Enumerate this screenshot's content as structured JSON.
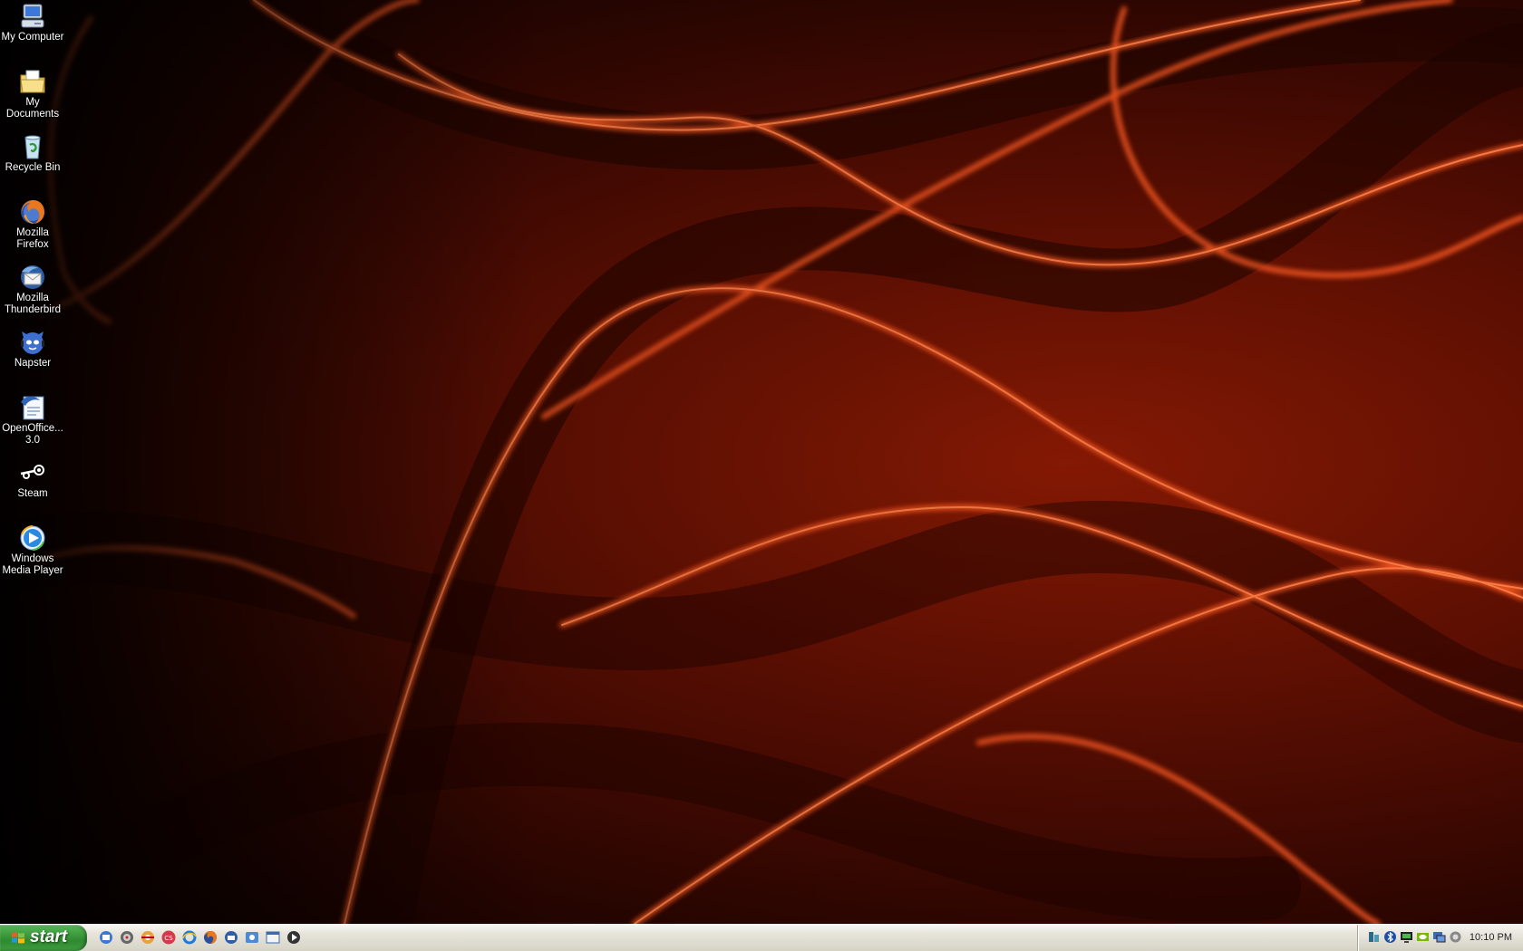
{
  "desktop": {
    "icons": [
      {
        "label": "My Computer",
        "icon": "my-computer-icon"
      },
      {
        "label": "My Documents",
        "icon": "my-documents-icon"
      },
      {
        "label": "Recycle Bin",
        "icon": "recycle-bin-icon"
      },
      {
        "label": "Mozilla Firefox",
        "icon": "firefox-icon"
      },
      {
        "label": "Mozilla Thunderbird",
        "icon": "thunderbird-icon"
      },
      {
        "label": "Napster",
        "icon": "napster-icon"
      },
      {
        "label": "OpenOffice... 3.0",
        "icon": "openoffice-icon"
      },
      {
        "label": "Steam",
        "icon": "steam-icon"
      },
      {
        "label": "Windows Media Player",
        "icon": "windows-media-player-icon"
      }
    ]
  },
  "taskbar": {
    "start_label": "start",
    "quick_launch": [
      "show-desktop-icon",
      "gear-app-icon",
      "disc-app-icon",
      "cs-game-icon",
      "internet-explorer-icon",
      "firefox-icon",
      "thunderbird-icon",
      "network-app-icon",
      "window-app-icon",
      "media-player-icon"
    ],
    "tray_icons": [
      "network-tray-icon",
      "bluetooth-tray-icon",
      "monitor-tray-icon",
      "nvidia-tray-icon",
      "display-tray-icon",
      "volume-tray-icon"
    ],
    "clock": "10:10 PM"
  },
  "colors": {
    "wallpaper_dark": "#2a0501",
    "wallpaper_mid": "#8a1a04",
    "flame_highlight": "#ff5a20",
    "start_green": "#3c9a3c",
    "taskbar_bg": "#e8e6dc"
  }
}
